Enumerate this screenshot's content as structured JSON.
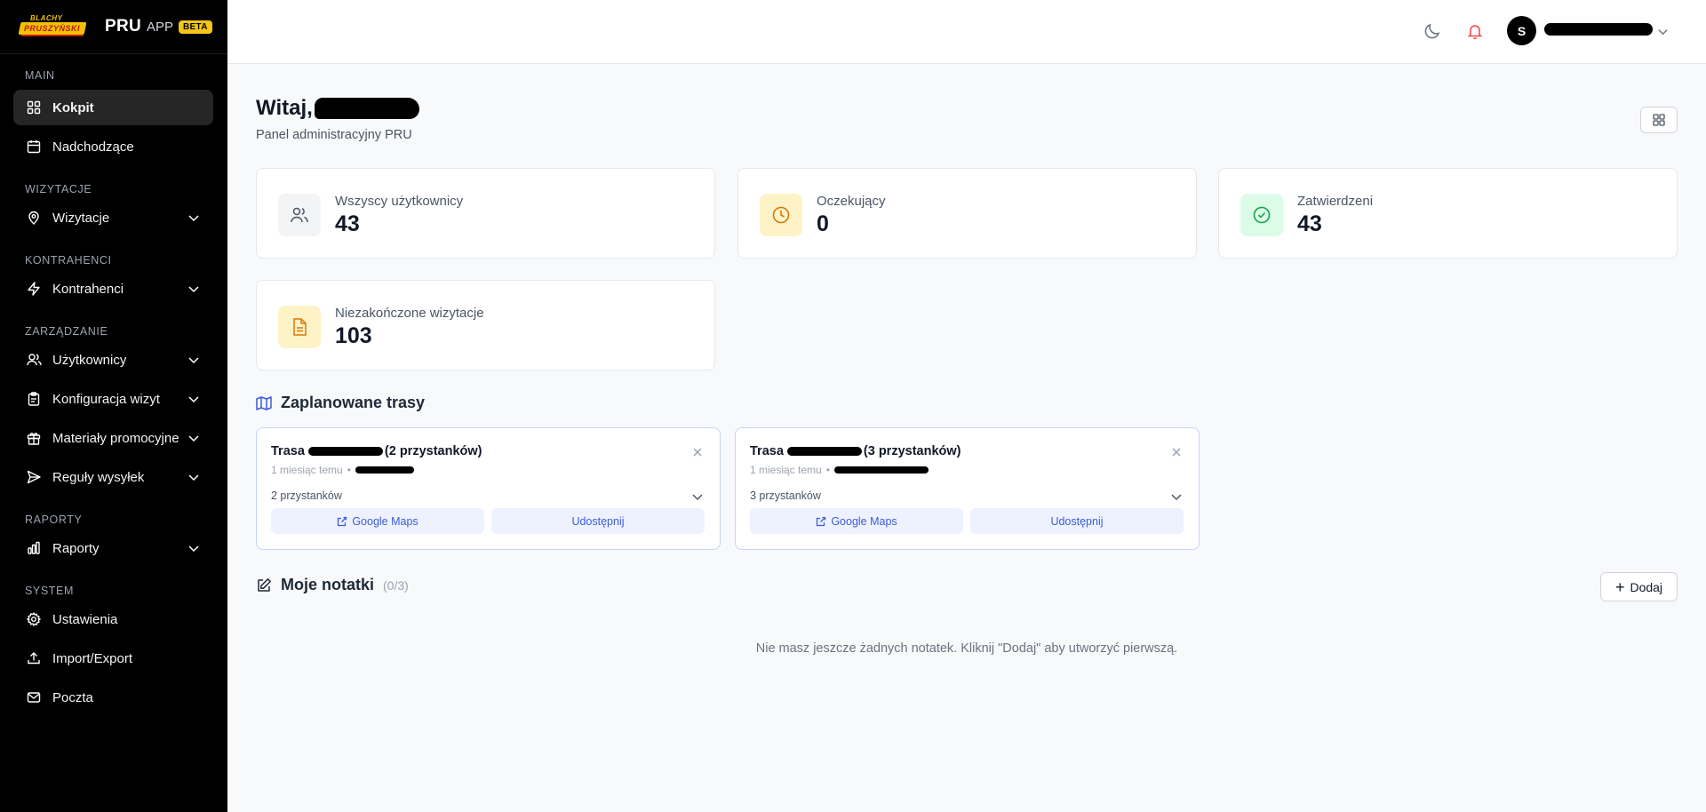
{
  "brand": {
    "logo_top": "BLACHY",
    "logo_main": "PRUSZYŃSKI",
    "name": "PRU",
    "app": "APP",
    "badge": "BETA"
  },
  "sidebar": {
    "sections": {
      "main": "MAIN",
      "wizytacje": "WIZYTACJE",
      "kontrahenci": "KONTRAHENCI",
      "zarzadzanie": "ZARZĄDZANIE",
      "raporty": "RAPORTY",
      "system": "SYSTEM"
    },
    "items": {
      "kokpit": "Kokpit",
      "nadchodzace": "Nadchodzące",
      "wizytacje": "Wizytacje",
      "kontrahenci": "Kontrahenci",
      "uzytkownicy": "Użytkownicy",
      "konfiguracja": "Konfiguracja wizyt",
      "materialy": "Materiały promocyjne",
      "reguly": "Reguły wysyłek",
      "raporty": "Raporty",
      "ustawienia": "Ustawienia",
      "import_export": "Import/Export",
      "poczta": "Poczta"
    }
  },
  "header": {
    "avatar_initial": "S"
  },
  "main": {
    "greeting": "Witaj,",
    "subtitle": "Panel administracyjny PRU",
    "stats": [
      {
        "label": "Wszyscy użytkownicy",
        "value": "43",
        "icon": "users-icon"
      },
      {
        "label": "Oczekujący",
        "value": "0",
        "icon": "clock-icon"
      },
      {
        "label": "Zatwierdzeni",
        "value": "43",
        "icon": "check-circle-icon"
      },
      {
        "label": "Niezakończone wizytacje",
        "value": "103",
        "icon": "document-icon"
      }
    ],
    "routes_title": "Zaplanowane trasy",
    "routes": [
      {
        "prefix": "Trasa",
        "stops_paren": "(2 przystanków)",
        "time": "1 miesiąc temu",
        "stops": "2 przystanków",
        "maps": "Google Maps",
        "share": "Udostępnij"
      },
      {
        "prefix": "Trasa",
        "stops_paren": "(3 przystanków)",
        "time": "1 miesiąc temu",
        "stops": "3 przystanków",
        "maps": "Google Maps",
        "share": "Udostępnij"
      }
    ],
    "notes_title": "Moje notatki",
    "notes_count": "(0/3)",
    "add_label": "Dodaj",
    "empty_text": "Nie masz jeszcze żadnych notatek. Kliknij \"Dodaj\" aby utworzyć pierwszą."
  },
  "colors": {
    "sidebar_bg": "#000000",
    "accent_blue": "#3b5bdb",
    "beta_badge": "#f5c518",
    "bell": "#ef4444"
  }
}
